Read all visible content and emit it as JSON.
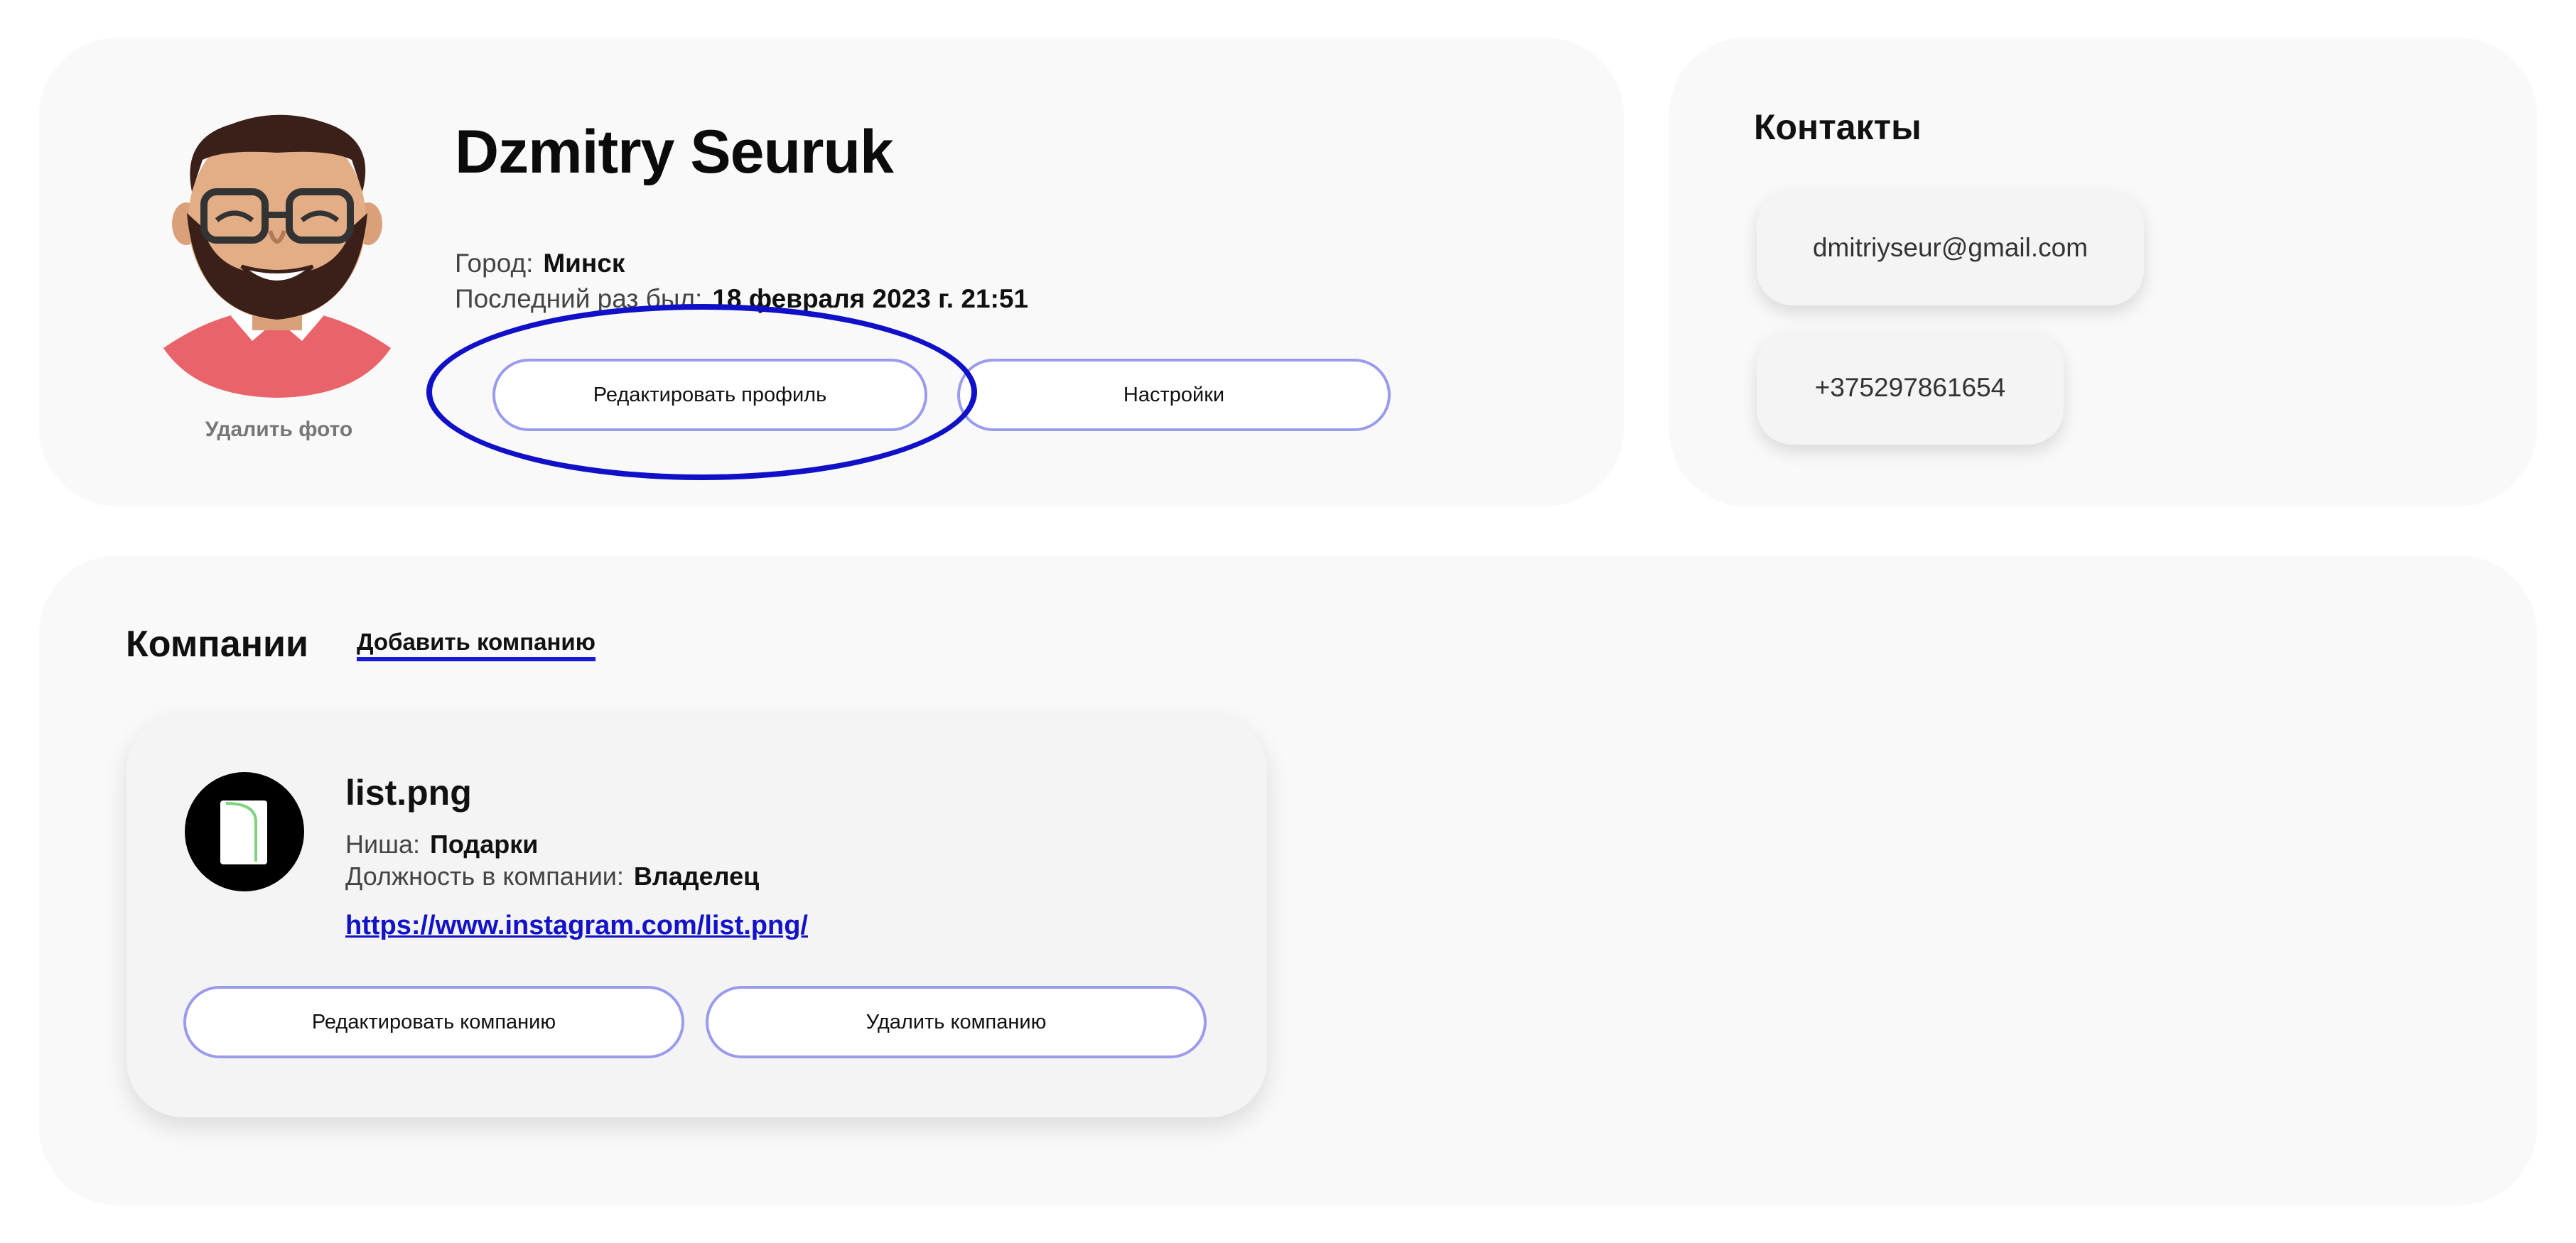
{
  "profile": {
    "name": "Dzmitry Seuruk",
    "city_label": "Город:",
    "city_value": "Минск",
    "last_seen_label": "Последний раз был:",
    "last_seen_value": "18 февраля 2023 г. 21:51",
    "delete_photo_label": "Удалить фото",
    "edit_profile_label": "Редактировать профиль",
    "settings_label": "Настройки"
  },
  "contacts": {
    "title": "Контакты",
    "email": "dmitriyseur@gmail.com",
    "phone": "+375297861654"
  },
  "companies": {
    "title": "Компании",
    "add_label": "Добавить компанию",
    "items": [
      {
        "name": "list.png",
        "niche_label": "Ниша:",
        "niche_value": "Подарки",
        "position_label": "Должность в компании:",
        "position_value": "Владелец",
        "link": "https://www.instagram.com/list.png/",
        "edit_label": "Редактировать компанию",
        "delete_label": "Удалить компанию"
      }
    ]
  },
  "colors": {
    "panel_bg": "#f9f9f9",
    "button_border": "#9b9bee",
    "highlight": "#1010c8",
    "link": "#1212c8",
    "avatar_shirt": "#e8636a"
  },
  "icons": {
    "avatar": "user-avatar-cartoon",
    "company_logo": "document-icon"
  }
}
